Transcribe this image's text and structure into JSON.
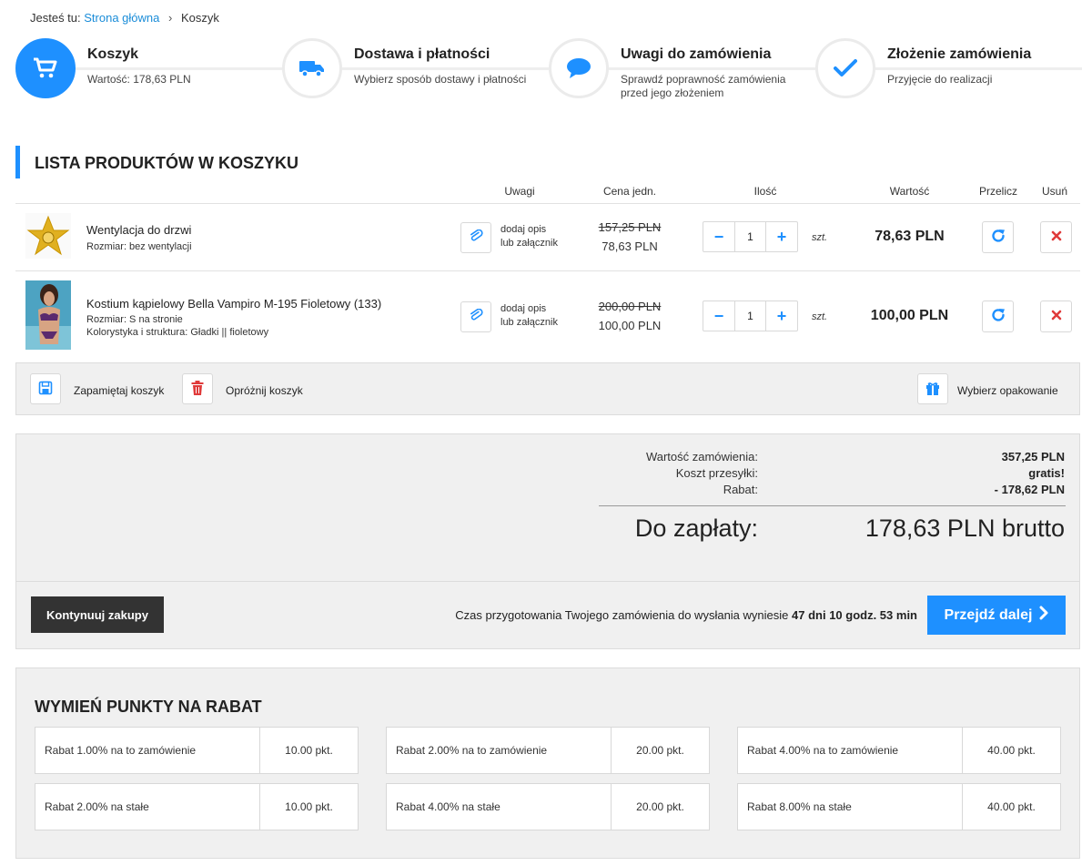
{
  "breadcrumb": {
    "prefix": "Jesteś tu:",
    "home": "Strona główna",
    "sep": "›",
    "current": "Koszyk"
  },
  "steps": [
    {
      "title": "Koszyk",
      "desc": "Wartość: 178,63 PLN",
      "icon": "cart-icon"
    },
    {
      "title": "Dostawa i płatności",
      "desc": "Wybierz sposób dostawy i płatności",
      "icon": "truck-icon"
    },
    {
      "title": "Uwagi do zamówienia",
      "desc": "Sprawdź poprawność zamówienia przed jego złożeniem",
      "icon": "chat-icon"
    },
    {
      "title": "Złożenie zamówienia",
      "desc": "Przyjęcie do realizacji",
      "icon": "check-icon"
    }
  ],
  "cart": {
    "heading": "LISTA PRODUKTÓW W KOSZYKU",
    "columns": {
      "notes": "Uwagi",
      "unit_price": "Cena jedn.",
      "qty": "Ilość",
      "value": "Wartość",
      "recalc": "Przelicz",
      "remove": "Usuń"
    },
    "items": [
      {
        "name": "Wentylacja do drzwi",
        "attrs": [
          "Rozmiar: bez wentylacji"
        ],
        "note_line1": "dodaj opis",
        "note_line2": "lub załącznik",
        "old_price": "157,25 PLN",
        "price": "78,63 PLN",
        "qty": "1",
        "unit": "szt.",
        "total": "78,63 PLN"
      },
      {
        "name": "Kostium kąpielowy Bella Vampiro M-195 Fioletowy (133)",
        "attrs": [
          "Rozmiar: S na stronie",
          "Kolorystyka i struktura: Gładki || fioletowy"
        ],
        "note_line1": "dodaj opis",
        "note_line2": "lub załącznik",
        "old_price": "200,00 PLN",
        "price": "100,00 PLN",
        "qty": "1",
        "unit": "szt.",
        "total": "100,00 PLN"
      }
    ],
    "qty_minus": "−",
    "qty_plus": "+"
  },
  "toolbar": {
    "save": "Zapamiętaj koszyk",
    "empty": "Opróżnij koszyk",
    "wrap": "Wybierz opakowanie"
  },
  "summary": {
    "order_value_label": "Wartość zamówienia:",
    "order_value": "357,25 PLN",
    "shipping_label": "Koszt przesyłki:",
    "shipping": "gratis!",
    "discount_label": "Rabat:",
    "discount": "- 178,62 PLN",
    "to_pay_label": "Do zapłaty:",
    "to_pay": "178,63 PLN brutto",
    "continue": "Kontynuuj zakupy",
    "prep_text": "Czas przygotowania Twojego zamówienia do wysłania wyniesie",
    "prep_time": "47 dni 10 godz. 53 min",
    "next": "Przejdź dalej"
  },
  "points": {
    "heading": "WYMIEŃ PUNKTY NA RABAT",
    "offers": [
      {
        "label": "Rabat 1.00% na to zamówienie",
        "points": "10.00 pkt."
      },
      {
        "label": "Rabat 2.00% na to zamówienie",
        "points": "20.00 pkt."
      },
      {
        "label": "Rabat 4.00% na to zamówienie",
        "points": "40.00 pkt."
      },
      {
        "label": "Rabat 2.00% na stałe",
        "points": "10.00 pkt."
      },
      {
        "label": "Rabat 4.00% na stałe",
        "points": "20.00 pkt."
      },
      {
        "label": "Rabat 8.00% na stałe",
        "points": "40.00 pkt."
      }
    ]
  },
  "colors": {
    "accent": "#1e90ff",
    "danger": "#e03a3a",
    "dark_button": "#333333",
    "panel": "#f0f0f0"
  }
}
